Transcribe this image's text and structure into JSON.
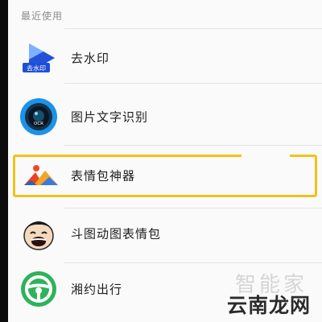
{
  "section": {
    "title": "最近使用"
  },
  "apps": [
    {
      "name": "去水印",
      "icon": "watermark-remove-play-icon",
      "icon_text": "去水印",
      "color": "#2f6bf0"
    },
    {
      "name": "图片文字识别",
      "icon": "ocr-camera-lens-icon",
      "icon_text": "OCR",
      "color": "#2ba5f5"
    },
    {
      "name": "表情包神器",
      "icon": "mountain-picture-icon",
      "color": "#f05a28"
    },
    {
      "name": "斗图动图表情包",
      "icon": "laughing-face-icon",
      "color": "#f3d7b5"
    },
    {
      "name": "湘约出行",
      "icon": "steering-wheel-icon",
      "color": "#2fb25a"
    }
  ],
  "highlight": {
    "color": "#f2c21b"
  },
  "watermark": {
    "text": "云南龙网",
    "faint_text": "智能家"
  }
}
